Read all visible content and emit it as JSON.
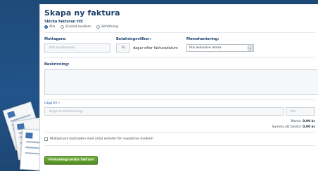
{
  "page": {
    "title": "Skapa ny faktura"
  },
  "send_to": {
    "label": "Skicka fakturan till:",
    "options": [
      {
        "label": "Alla",
        "selected": true
      },
      {
        "label": "Enskild medlem",
        "selected": false
      },
      {
        "label": "Befattning",
        "selected": false
      }
    ]
  },
  "recipient": {
    "label": "Mottagare:",
    "placeholder": "Alla medlemmar"
  },
  "payment_terms": {
    "label": "Betalningsvillkor:",
    "days_value": "30",
    "suffix": "dagar efter fakturadatum"
  },
  "vat": {
    "label": "Momshantering:",
    "selected": "Pris exklusive moms"
  },
  "description": {
    "label": "Beskrivning:",
    "value": ""
  },
  "line_items": {
    "add_link": "Lägg till »",
    "name_placeholder": "Ange en beskrivning...",
    "price_placeholder": "Pris"
  },
  "totals": {
    "vat_label": "Moms:",
    "vat_value": "0,00 kr",
    "total_label": "Summa att betala:",
    "total_value": "0,00 kr"
  },
  "multiply": {
    "label": "Multiplicera kostnaden med antal enheter för respektive medlem",
    "checked": false
  },
  "actions": {
    "preview_label": "Förhandsgranska faktura"
  },
  "colors": {
    "background": "#1f4d7c",
    "heading": "#1d3f6b",
    "accent_green": "#5d9a29",
    "link": "#2a5f9c"
  }
}
